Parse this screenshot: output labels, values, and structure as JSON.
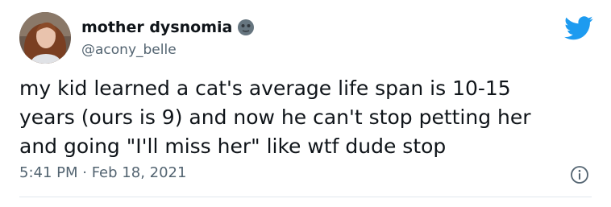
{
  "tweet": {
    "author": {
      "display_name": "mother dysnomia",
      "handle": "@acony_belle",
      "name_emoji": "new-moon-face-emoji",
      "avatar": "profile-photo"
    },
    "text": "my kid learned a cat's average life span is 10-15\nyears (ours is 9) and now he can't stop petting her\nand going \"I'll miss her\" like wtf dude stop",
    "timestamp": "5:41 PM · Feb 18, 2021",
    "icons": {
      "brand": "twitter-bird-icon",
      "info": "info-icon"
    }
  },
  "colors": {
    "brand_blue": "#1d9bf0",
    "text_primary": "#0f1419",
    "text_secondary": "#536471",
    "divider": "#e1e8ed"
  }
}
